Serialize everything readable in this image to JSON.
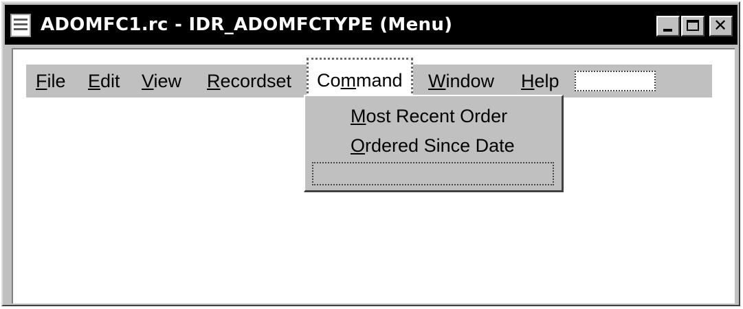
{
  "window": {
    "title": "ADOMFC1.rc - IDR_ADOMFCTYPE (Menu)"
  },
  "titlebar_buttons": {
    "minimize_icon": "minimize-icon",
    "maximize_icon": "maximize-icon",
    "close_icon": "close-icon",
    "close_glyph": "✕"
  },
  "menubar": {
    "items": [
      {
        "pre": "",
        "accel": "F",
        "post": "ile"
      },
      {
        "pre": "",
        "accel": "E",
        "post": "dit"
      },
      {
        "pre": "",
        "accel": "V",
        "post": "iew"
      },
      {
        "pre": "",
        "accel": "R",
        "post": "ecordset"
      },
      {
        "pre": "Co",
        "accel": "m",
        "post": "mand"
      },
      {
        "pre": "",
        "accel": "W",
        "post": "indow"
      },
      {
        "pre": "",
        "accel": "H",
        "post": "elp"
      }
    ],
    "selected_index": 4
  },
  "dropdown": {
    "items": [
      {
        "pre": "",
        "accel": "M",
        "post": "ost Recent Order"
      },
      {
        "pre": "",
        "accel": "O",
        "post": "rdered Since Date"
      }
    ]
  }
}
